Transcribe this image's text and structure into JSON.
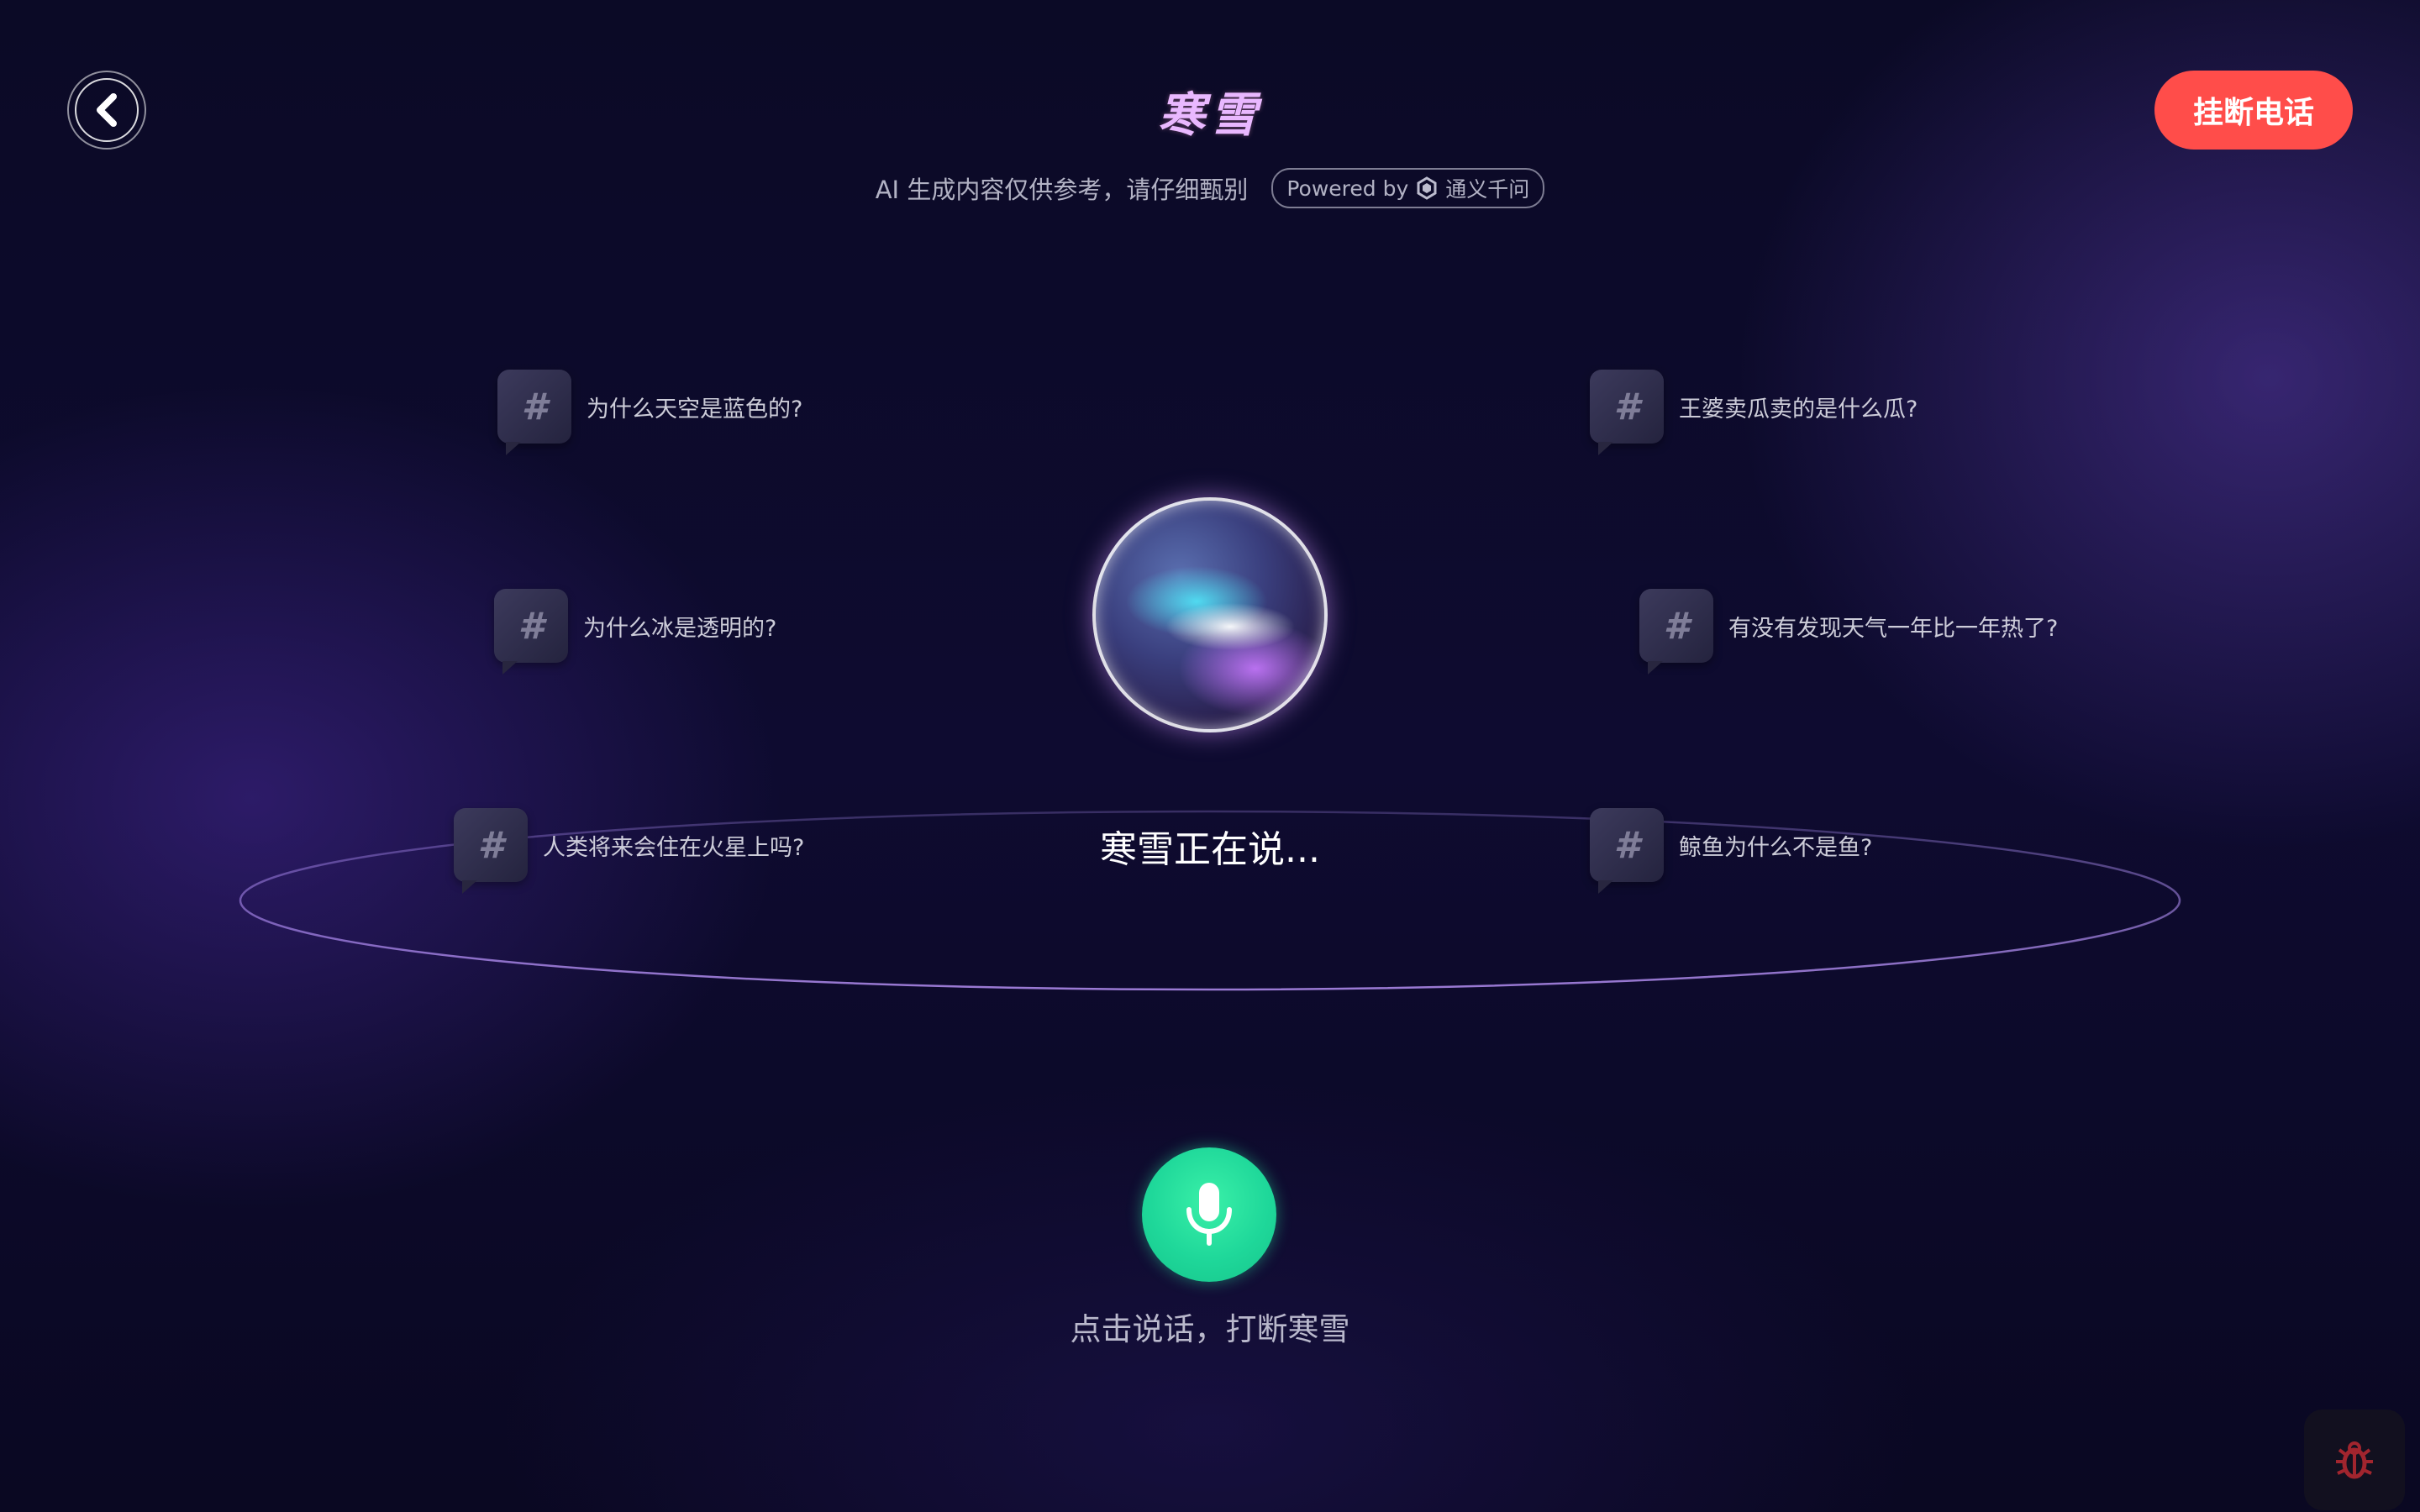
{
  "header": {
    "title": "寒雪",
    "subtitle": "AI 生成内容仅供参考，请仔细甄别",
    "powered_label": "Powered by",
    "powered_brand": "通义千问",
    "hangup_label": "挂断电话"
  },
  "suggestions": [
    {
      "icon": "#",
      "text": "为什么天空是蓝色的?"
    },
    {
      "icon": "#",
      "text": "王婆卖瓜卖的是什么瓜?"
    },
    {
      "icon": "#",
      "text": "为什么冰是透明的?"
    },
    {
      "icon": "#",
      "text": "有没有发现天气一年比一年热了?"
    },
    {
      "icon": "#",
      "text": "人类将来会住在火星上吗?"
    },
    {
      "icon": "#",
      "text": "鲸鱼为什么不是鱼?"
    }
  ],
  "status": {
    "speaking_text": "寒雪正在说..."
  },
  "mic": {
    "hint": "点击说话，打断寒雪"
  },
  "colors": {
    "hangup": "#ff4d4a",
    "mic": "#1fd89a",
    "title": "#e9b8ff"
  },
  "icons": {
    "back": "chevron-left-icon",
    "powered_logo": "qwen-logo-icon",
    "mic": "microphone-icon",
    "debug": "bug-icon"
  }
}
